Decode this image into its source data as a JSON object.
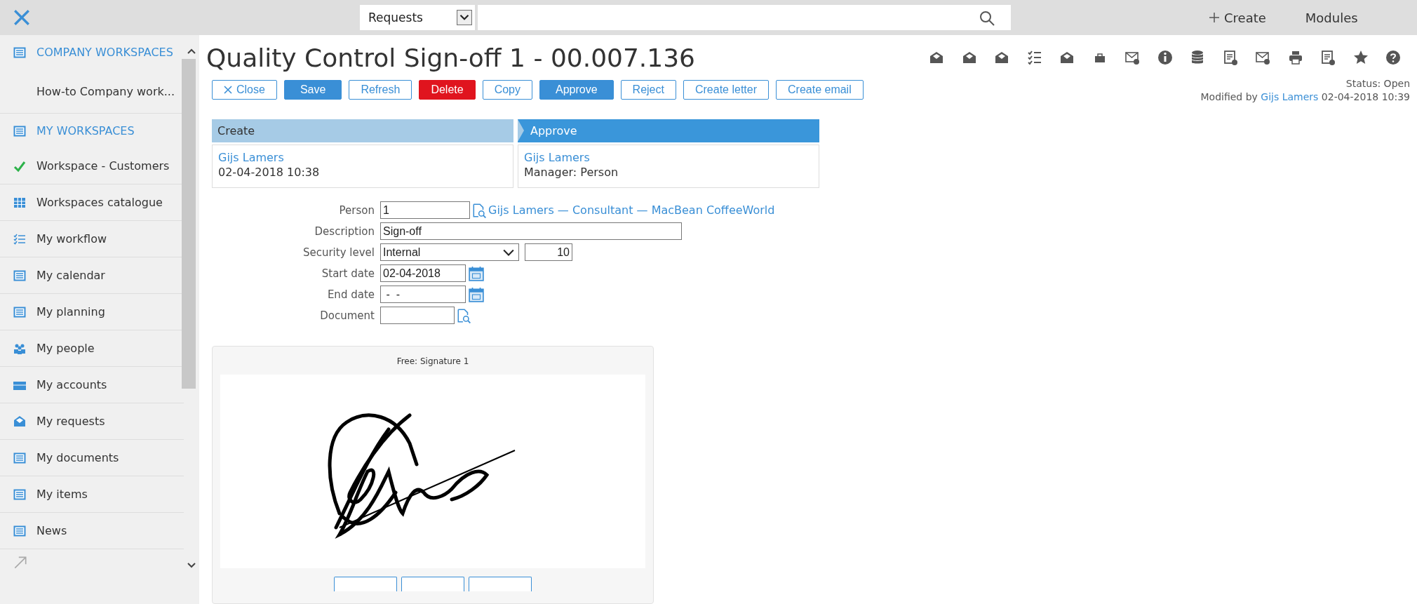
{
  "topbar": {
    "search_scope": "Requests",
    "create": "Create",
    "modules": "Modules"
  },
  "sidebar": {
    "items": [
      {
        "kind": "section",
        "label": "COMPANY WORKSPACES"
      },
      {
        "kind": "sub",
        "label": "How-to Company work..."
      },
      {
        "kind": "section",
        "label": "MY WORKSPACES"
      },
      {
        "kind": "checked",
        "label": "Workspace - Customers"
      },
      {
        "kind": "item",
        "label": "Workspaces catalogue"
      },
      {
        "kind": "item",
        "label": "My workflow"
      },
      {
        "kind": "item",
        "label": "My calendar"
      },
      {
        "kind": "item",
        "label": "My planning"
      },
      {
        "kind": "item",
        "label": "My people"
      },
      {
        "kind": "item",
        "label": "My accounts"
      },
      {
        "kind": "item",
        "label": "My requests"
      },
      {
        "kind": "item",
        "label": "My documents"
      },
      {
        "kind": "item",
        "label": "My items"
      },
      {
        "kind": "item",
        "label": "News"
      }
    ]
  },
  "record": {
    "title": "Quality Control Sign-off 1 - 00.007.136",
    "buttons": [
      {
        "kind": "close",
        "label": "Close"
      },
      {
        "kind": "primary",
        "label": "Save"
      },
      {
        "kind": "outline",
        "label": "Refresh"
      },
      {
        "kind": "danger",
        "label": "Delete"
      },
      {
        "kind": "outline",
        "label": "Copy"
      },
      {
        "kind": "primary",
        "label": "Approve"
      },
      {
        "kind": "outline",
        "label": "Reject"
      },
      {
        "kind": "outline",
        "label": "Create letter"
      },
      {
        "kind": "outline",
        "label": "Create email"
      }
    ],
    "status": "Status: Open",
    "modified_prefix": "Modified by",
    "modified_by": "Gijs Lamers",
    "modified_at": "02-04-2018 10:39"
  },
  "stages": [
    {
      "title": "Create",
      "selected": false,
      "name": "Gijs Lamers",
      "detail": "02-04-2018 10:38"
    },
    {
      "title": "Approve",
      "selected": true,
      "name": "Gijs Lamers",
      "detail": "Manager: Person"
    }
  ],
  "form": {
    "person_label": "Person",
    "person_value": "1",
    "person_link": "Gijs Lamers — Consultant — MacBean CoffeeWorld",
    "description_label": "Description",
    "description_value": "Sign-off",
    "security_label": "Security level",
    "security_value": "Internal",
    "security_number": "10",
    "start_label": "Start date",
    "start_value": "02-04-2018",
    "end_label": "End date",
    "end_value": " -  -",
    "document_label": "Document"
  },
  "signature": {
    "title": "Free: Signature 1"
  }
}
